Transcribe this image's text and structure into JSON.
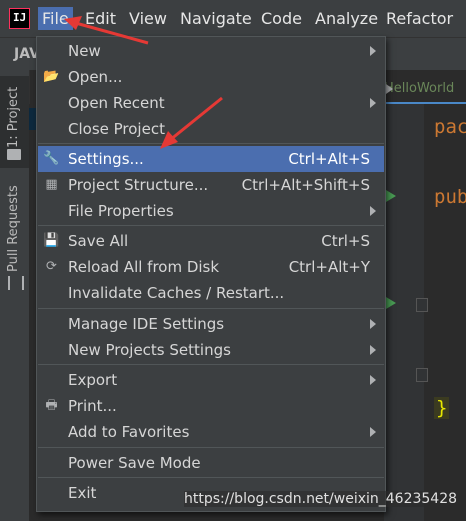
{
  "menubar": {
    "items": [
      "File",
      "Edit",
      "View",
      "Navigate",
      "Code",
      "Analyze",
      "Refactor"
    ]
  },
  "toolbar": {
    "project_label": "JAV"
  },
  "editor": {
    "tab": "HelloWorld",
    "line1": "pac",
    "line2": "pub",
    "brace": "}"
  },
  "sidebar": {
    "project_tab": "1: Project",
    "pull_requests_tab": "Pull Requests"
  },
  "file_menu": {
    "new": "New",
    "open": "Open...",
    "open_recent": "Open Recent",
    "close_project": "Close Project",
    "settings": "Settings...",
    "settings_shortcut": "Ctrl+Alt+S",
    "project_structure": "Project Structure...",
    "project_structure_shortcut": "Ctrl+Alt+Shift+S",
    "file_properties": "File Properties",
    "save_all": "Save All",
    "save_all_shortcut": "Ctrl+S",
    "reload": "Reload All from Disk",
    "reload_shortcut": "Ctrl+Alt+Y",
    "invalidate": "Invalidate Caches / Restart...",
    "manage_ide": "Manage IDE Settings",
    "new_projects": "New Projects Settings",
    "export": "Export",
    "print": "Print...",
    "add_favorites": "Add to Favorites",
    "power_save": "Power Save Mode",
    "exit": "Exit"
  },
  "watermark": "https://blog.csdn.net/weixin_46235428",
  "colors": {
    "accent": "#4b6eaf",
    "annotation": "#e53935"
  }
}
